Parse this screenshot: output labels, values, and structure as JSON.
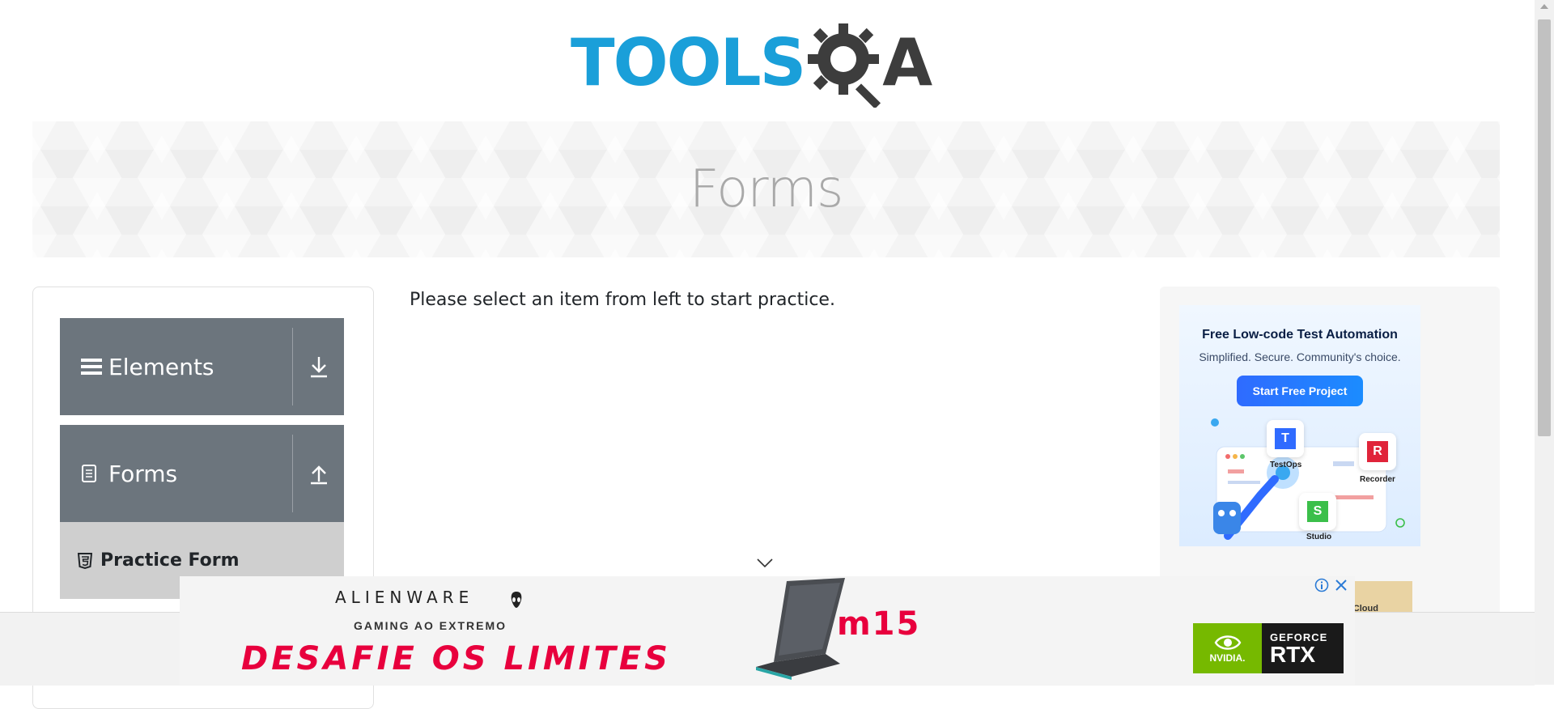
{
  "header": {
    "logo_main": "TOOLS",
    "logo_accent": "A",
    "logo_alt": "TOOLSQA"
  },
  "banner": {
    "title": "Forms"
  },
  "sidebar": {
    "groups": [
      {
        "label": "Elements",
        "icon": "hamburger-icon",
        "toggle_icon": "download-arrow-icon",
        "expanded": false
      },
      {
        "label": "Forms",
        "icon": "document-icon",
        "toggle_icon": "upload-arrow-icon",
        "expanded": true
      }
    ],
    "active_item": {
      "label": "Practice Form",
      "icon": "html5-icon"
    }
  },
  "main": {
    "message": "Please select an item from left to start practice."
  },
  "right_ad": {
    "title": "Free Low-code Test Automation",
    "subtitle": "Simplified. Secure. Community's choice.",
    "button": "Start Free Project",
    "apps": [
      {
        "name": "TestOps",
        "letter": "T",
        "color": "#2f6bff"
      },
      {
        "name": "Recorder",
        "letter": "R",
        "color": "#e0243a"
      },
      {
        "name": "Studio",
        "letter": "S",
        "color": "#3bbf4a"
      }
    ],
    "peek_text": "n Cloud"
  },
  "bottom_ad": {
    "brand": "ALIENWARE",
    "tagline": "GAMING AO EXTREMO",
    "slogan": "DESAFIE OS LIMITES",
    "model": "m15",
    "nvidia_label": "NVIDIA.",
    "geforce": "GEFORCE",
    "rtx": "RTX"
  },
  "colors": {
    "logo_blue": "#1a9fd9",
    "logo_dark": "#3d3d3d",
    "sidebar_header_bg": "#6c757d",
    "active_item_bg": "#cfcfcf",
    "alienware_red": "#e8003d",
    "nvidia_green": "#76b900"
  }
}
